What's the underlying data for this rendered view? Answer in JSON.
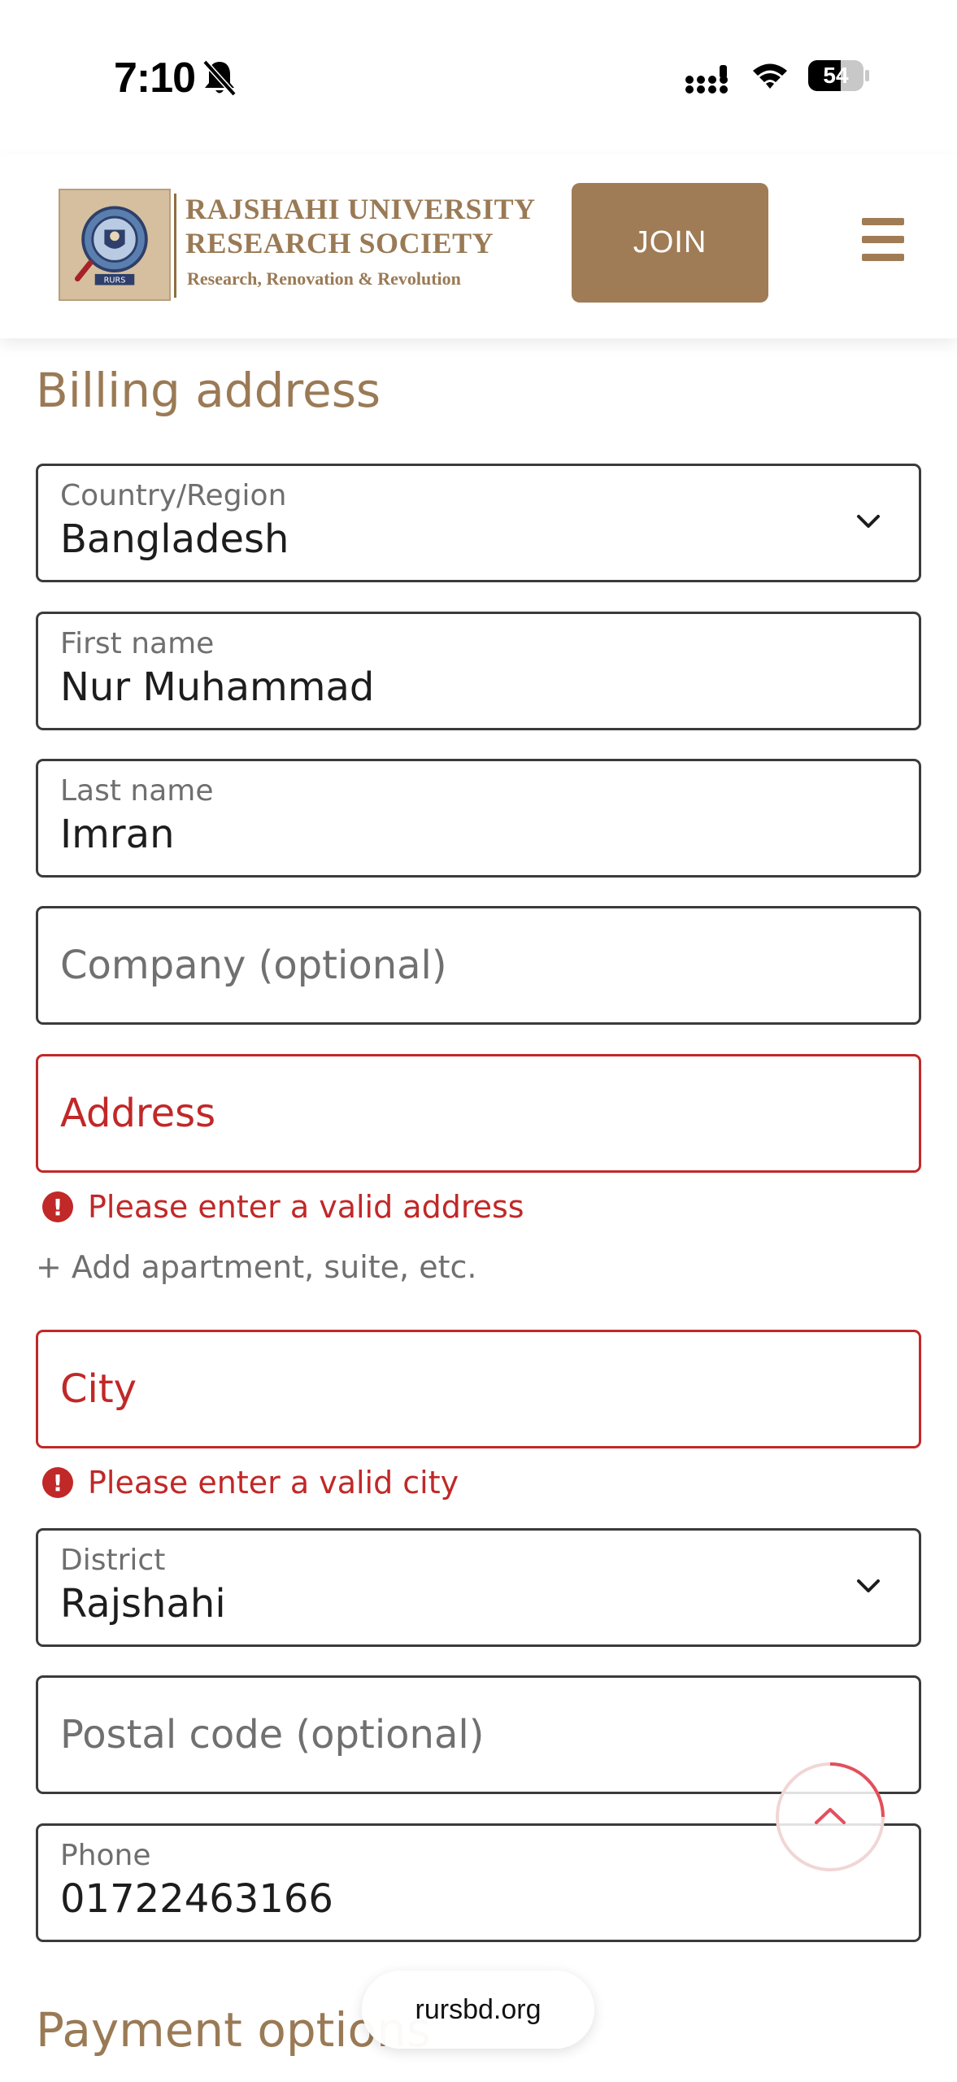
{
  "status_bar": {
    "time": "7:10",
    "battery": "54"
  },
  "header": {
    "logo": {
      "line1": "RAJSHAHI UNIVERSITY",
      "line2": "RESEARCH SOCIETY",
      "tagline": "Research, Renovation & Revolution",
      "emblem_text": "RURS"
    },
    "join_label": "JOIN"
  },
  "billing": {
    "title": "Billing address",
    "country": {
      "label": "Country/Region",
      "value": "Bangladesh"
    },
    "first_name": {
      "label": "First name",
      "value": "Nur Muhammad"
    },
    "last_name": {
      "label": "Last name",
      "value": "Imran"
    },
    "company": {
      "placeholder": "Company (optional)"
    },
    "address": {
      "placeholder": "Address",
      "error": "Please enter a valid address"
    },
    "add_apartment": "+ Add apartment, suite, etc.",
    "city": {
      "placeholder": "City",
      "error": "Please enter a valid city"
    },
    "district": {
      "label": "District",
      "value": "Rajshahi"
    },
    "postal": {
      "placeholder": "Postal code (optional)"
    },
    "phone": {
      "label": "Phone",
      "value": "01722463166"
    }
  },
  "payment": {
    "title": "Payment options"
  },
  "browser": {
    "url": "rursbd.org"
  },
  "colors": {
    "brand": "#9f7c56",
    "error": "#c12828",
    "border": "#3b3b3b"
  }
}
